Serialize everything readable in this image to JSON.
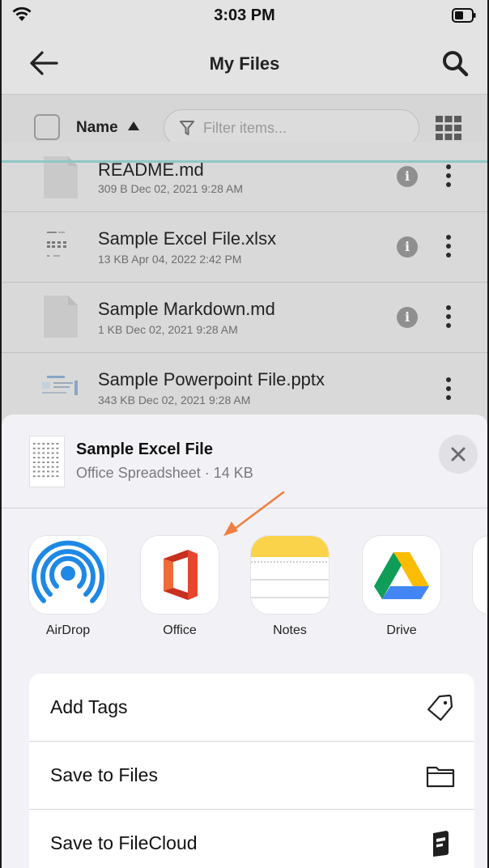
{
  "status_bar": {
    "time": "3:03 PM"
  },
  "nav": {
    "title": "My Files"
  },
  "toolbar": {
    "sort_label": "Name",
    "filter_placeholder": "Filter items..."
  },
  "files": [
    {
      "name": "README.md",
      "meta": "309 B Dec 02, 2021 9:28 AM",
      "thumb": "blank-file-icon",
      "has_info": true
    },
    {
      "name": "Sample Excel File.xlsx",
      "meta": "13 KB Apr 04, 2022 2:42 PM",
      "thumb": "spreadsheet-thumbnail",
      "has_info": true
    },
    {
      "name": "Sample Markdown.md",
      "meta": "1 KB Dec 02, 2021 9:28 AM",
      "thumb": "blank-file-icon",
      "has_info": true
    },
    {
      "name": "Sample Powerpoint File.pptx",
      "meta": "343 KB Dec 02, 2021 9:28 AM",
      "thumb": "slide-thumbnail",
      "has_info": false
    }
  ],
  "share_sheet": {
    "title": "Sample Excel File",
    "subtitle": "Office Spreadsheet · 14 KB",
    "apps": [
      {
        "label": "AirDrop",
        "icon": "airdrop-icon"
      },
      {
        "label": "Office",
        "icon": "office-icon"
      },
      {
        "label": "Notes",
        "icon": "notes-icon"
      },
      {
        "label": "Drive",
        "icon": "google-drive-icon"
      }
    ],
    "actions": [
      {
        "label": "Add Tags",
        "icon": "tag-icon"
      },
      {
        "label": "Save to Files",
        "icon": "folder-icon"
      },
      {
        "label": "Save to FileCloud",
        "icon": "filecloud-icon"
      }
    ]
  },
  "colors": {
    "accent_line": "#8fc7c7",
    "annotation_arrow": "#f08040",
    "office_red": "#e0402a",
    "notes_yellow": "#fbd34a",
    "airdrop_blue": "#1e88e5"
  }
}
